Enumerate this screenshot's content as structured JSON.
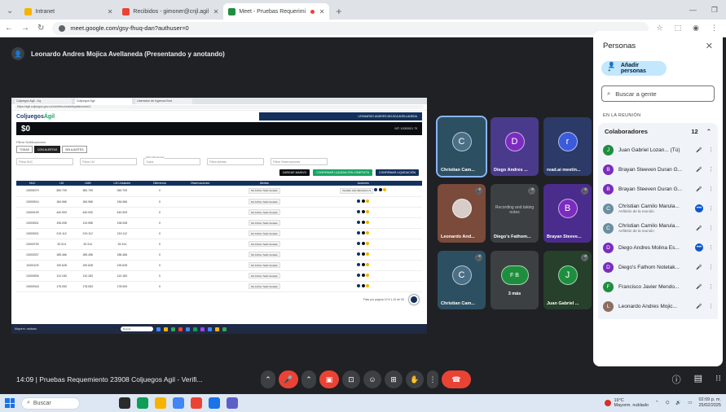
{
  "browser": {
    "tabs": [
      {
        "label": "Intranet",
        "color": "#f4b400",
        "active": false
      },
      {
        "label": "Recibidos - gimoner@cnjl.agil",
        "color": "#ea4335",
        "active": false
      },
      {
        "label": "Meet - Pruebas Requerimi",
        "color": "#1e8e3e",
        "active": true
      }
    ],
    "url": "meet.google.com/gsy-fhuq-dan?authuser=0"
  },
  "meet": {
    "presenter_title": "Leonardo Andres Mojica Avellaneda (Presentando y anotando)",
    "meeting_label": "14:09  |  Pruebas Requemiento 23908 Coljuegos Agil - Verifi...",
    "participant_count_badge": "12"
  },
  "shared_screen": {
    "tabs": [
      "Coljuegos Ágil - Liq",
      "Coljuegos Ágil",
      "Liberación de Ingresos Brut"
    ],
    "url": "https://agil.coljuegos.gov.co/contribuciones/liquidaciones/1",
    "logo_main": "Coljuegos",
    "logo_accent": "Ágil",
    "user_bar": "LEONARDO ANDRES MOJICA AVELLANEDA",
    "amount": "$0",
    "nit": "NIT: 10000001 79",
    "filter_title": "Filtrar Notificaciones",
    "filter_buttons": [
      "TODAS",
      "CON ALERTAS",
      "SIN AJUSTES"
    ],
    "inputs": [
      {
        "label": "",
        "placeholder": "Filtrar NUC"
      },
      {
        "label": "",
        "placeholder": "Filtrar LM"
      },
      {
        "label": "Filtro Diferencias",
        "placeholder": "Todos"
      },
      {
        "label": "",
        "placeholder": "Filtrar Alertas"
      },
      {
        "label": "",
        "placeholder": "Filtrar Observaciones"
      }
    ],
    "actions": [
      {
        "label": "CARGUE MASIVO",
        "color": "#0b0d11"
      },
      {
        "label": "CONFIRMAR LIQUIDACIÓN COMPLETA",
        "color": "#19a463"
      },
      {
        "label": "CONFIRMAR LIQUIDACIÓN",
        "color": "#13315c"
      }
    ],
    "columns": [
      "NUC",
      "LM",
      "LMM",
      "LM Unidades",
      "Diferencia",
      "Observaciones",
      "Alertas",
      "Acciones"
    ],
    "rows": [
      [
        "10000079",
        "360.709",
        "360.709",
        "360.709",
        "0",
        "",
        "Sin Ficha / Sello Venado",
        "Vendido sólo fabricacion 9"
      ],
      [
        "10000914",
        "184.966",
        "184.966",
        "184.966",
        "0",
        "",
        "Sin Ficha / Sello Venado",
        ""
      ],
      [
        "10000199",
        "440.993",
        "440.000",
        "440.993",
        "0",
        "",
        "Sin Ficha / Sello Venado",
        ""
      ],
      [
        "10000301",
        "196.008",
        "119.958",
        "196.008",
        "0",
        "",
        "Sin Ficha / Sello Venado",
        ""
      ],
      [
        "10000301",
        "219.112",
        "219.112",
        "219.112",
        "0",
        "",
        "Sin Ficha / Sello Venado",
        ""
      ],
      [
        "10000799",
        "33.314",
        "33.314",
        "33.314",
        "0",
        "",
        "Sin Ficha / Sello Venado",
        ""
      ],
      [
        "10000307",
        "185.466",
        "185.456",
        "185.466",
        "0",
        "",
        "Sin Ficha / Sello Venado",
        ""
      ],
      [
        "10001109",
        "190.628",
        "190.628",
        "190.628",
        "0",
        "",
        "Sin Ficha / Sello Venado",
        ""
      ],
      [
        "10000906",
        "110.183",
        "110.183",
        "110.183",
        "0",
        "",
        "Sin Ficha / Sello Venado",
        ""
      ],
      [
        "10000318",
        "178.053",
        "178.053",
        "178.053",
        "0",
        "",
        "Sin Ficha / Sello Venado",
        ""
      ]
    ],
    "pager": "Filas por página  10 ▾   1-10 de 53",
    "taskbar_weather": "Mayorm. nublado",
    "taskbar_search": "Buscar"
  },
  "tiles": [
    {
      "name": "Christian Cam...",
      "initial": "C",
      "bg": "#2d4f62",
      "av": "#4a6f86",
      "mute": false,
      "highlight": true
    },
    {
      "name": "Diego Andres ...",
      "initial": "D",
      "bg": "#4a3a8c",
      "av": "#7b2cbf",
      "mute": false
    },
    {
      "name": "read.ai meetin...",
      "initial": "r",
      "bg": "#2b3a67",
      "av": "#3b5bdb",
      "mute": false
    },
    {
      "name": "Leonardo And...",
      "initial": "",
      "bg": "#7a4a3a",
      "av": "#a0522d",
      "mute": true
    },
    {
      "name": "Diego's Fathom...",
      "initial": "",
      "bg": "#3c4043",
      "av": "#3c4043",
      "mute": true,
      "text": "Recording and taking notes"
    },
    {
      "name": "Brayan Steeve...",
      "initial": "B",
      "bg": "#4a2c8c",
      "av": "#7b2cbf",
      "mute": true
    },
    {
      "name": "Christian Cam...",
      "initial": "C",
      "bg": "#2d4f62",
      "av": "#4a6f86",
      "mute": true
    },
    {
      "name": "3 más",
      "initial": "F B",
      "bg": "#3c4043",
      "av": "#1e8e3e",
      "mute": false
    },
    {
      "name": "Juan Gabriel ...",
      "initial": "J",
      "bg": "#27402b",
      "av": "#1e8e3e",
      "mute": true
    }
  ],
  "people_panel": {
    "title": "Personas",
    "add_label": "Añadir personas",
    "search_placeholder": "Buscar a gente",
    "section": "EN LA REUNIÓN",
    "group_label": "Colaboradores",
    "group_count": "12",
    "people": [
      {
        "initial": "J",
        "color": "#1e8e3e",
        "name": "Juan Gabriel Lozan... (Tú)",
        "sub": "",
        "status": "mic-off"
      },
      {
        "initial": "B",
        "color": "#7b2cbf",
        "name": "Brayan Steeven Duran G...",
        "sub": "",
        "status": "mic-off"
      },
      {
        "initial": "B",
        "color": "#7b2cbf",
        "name": "Brayan Steeven Duran G...",
        "sub": "",
        "status": "mic-off"
      },
      {
        "initial": "C",
        "color": "#6b8e9f",
        "name": "Christian Camilo Marula...",
        "sub": "Anfitrión de la reunión",
        "status": "dots"
      },
      {
        "initial": "C",
        "color": "#6b8e9f",
        "name": "Christian Camilo Marula...",
        "sub": "Anfitrión de la reunión",
        "status": "mic-off"
      },
      {
        "initial": "D",
        "color": "#7b2cbf",
        "name": "Diego Andres Molina Es...",
        "sub": "",
        "status": "dots"
      },
      {
        "initial": "D",
        "color": "#7b2cbf",
        "name": "Diego's Fathom Notetak...",
        "sub": "",
        "status": "mic-off"
      },
      {
        "initial": "F",
        "color": "#1e8e3e",
        "name": "Francisco Javier Mendo...",
        "sub": "",
        "status": "mic-off"
      },
      {
        "initial": "L",
        "color": "#8d6e63",
        "name": "Leonardo Andres Mojic...",
        "sub": "",
        "status": "mic-off"
      }
    ]
  },
  "windows": {
    "search": "Buscar",
    "temp": "19°C",
    "weather": "Mayorm. nublado",
    "time": "02:09 p. m.",
    "date": "25/02/2025"
  },
  "colors": {
    "meet_bg": "#202124",
    "accent": "#c2e7ff",
    "end_call": "#ea4335"
  }
}
